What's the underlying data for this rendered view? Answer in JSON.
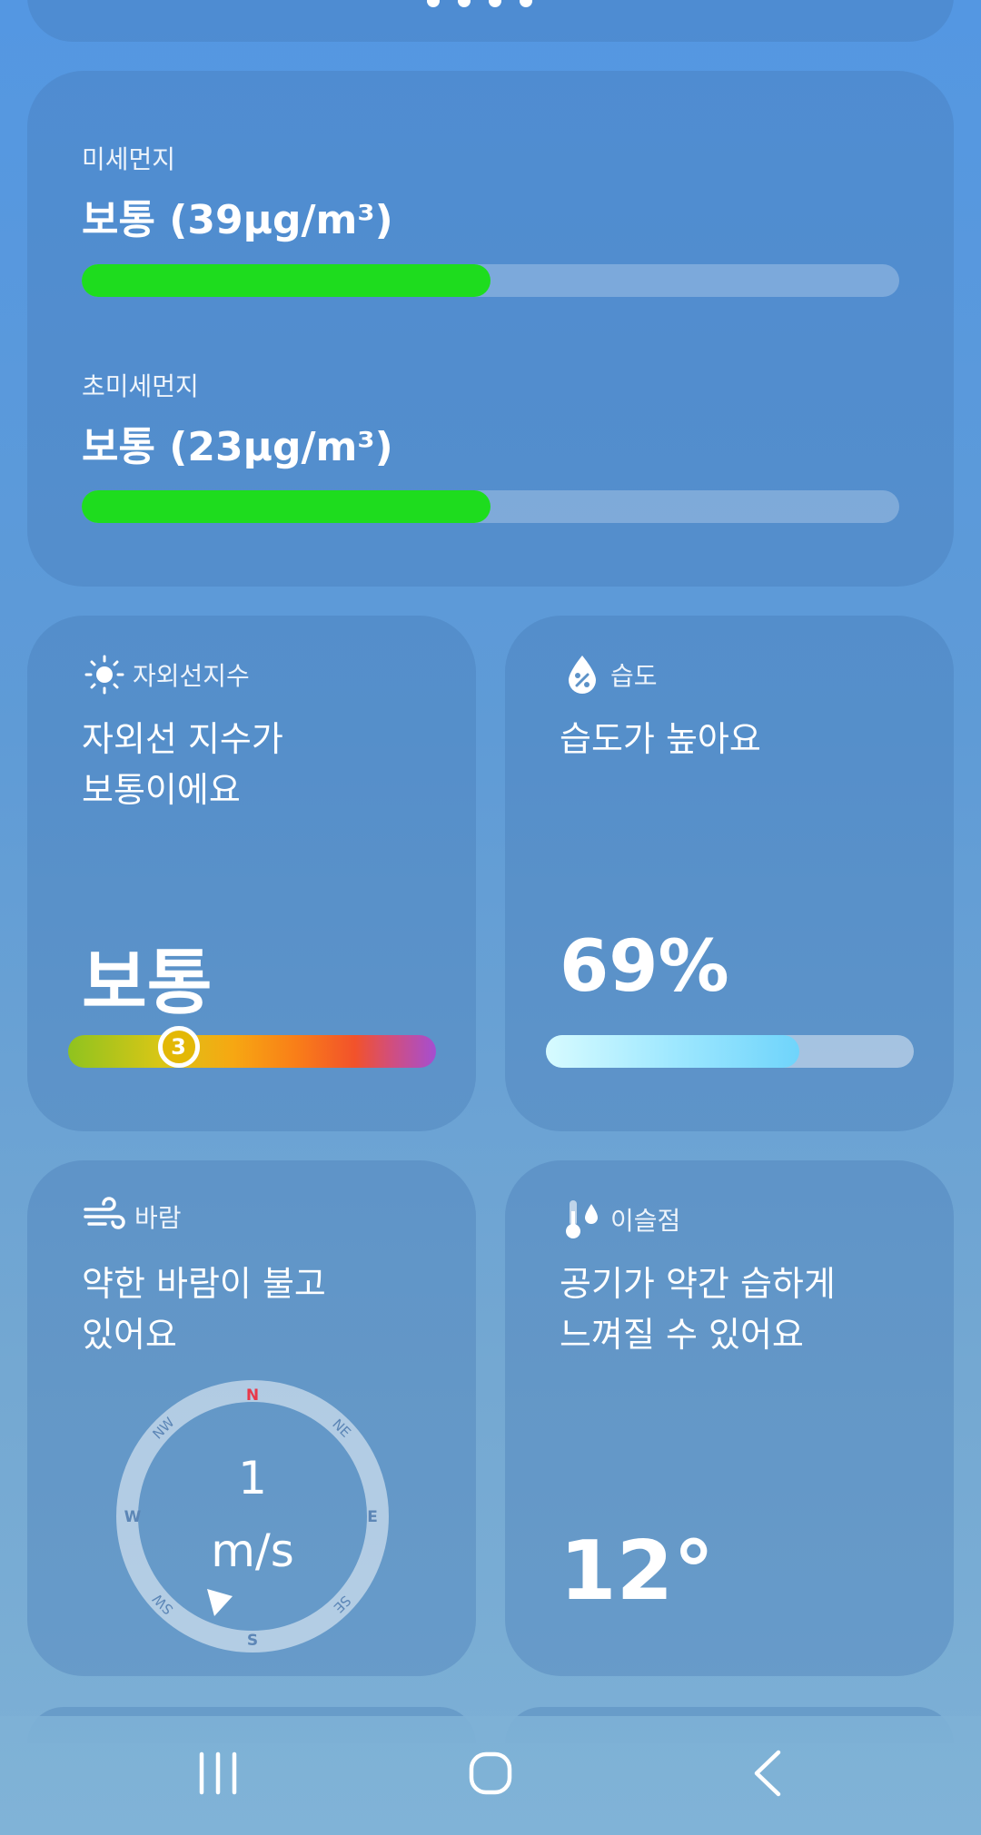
{
  "air_quality": {
    "fine_dust": {
      "label": "미세먼지",
      "value": "보통 (39μg/m³)",
      "level_fraction": 0.5
    },
    "ultrafine_dust": {
      "label": "초미세먼지",
      "value": "보통 (23μg/m³)",
      "level_fraction": 0.5
    },
    "good_color": "#1edc1e"
  },
  "uv": {
    "title": "자외선지수",
    "icon": "sun-icon",
    "description": "자외선 지수가\n보통이에요",
    "level": "보통",
    "index": "3",
    "index_fraction": 0.3
  },
  "humidity": {
    "title": "습도",
    "icon": "humidity-drop-icon",
    "description": "습도가 높아요",
    "value": "69%",
    "fraction": 0.69
  },
  "wind": {
    "title": "바람",
    "icon": "wind-icon",
    "description": "약한 바람이 불고\n있어요",
    "speed": "1",
    "unit": "m/s",
    "direction": "SW",
    "compass": {
      "N": "N",
      "NE": "NE",
      "E": "E",
      "SE": "SE",
      "S": "S",
      "SW": "SW",
      "W": "W",
      "NW": "NW"
    },
    "north_color": "#e8384a"
  },
  "dew_point": {
    "title": "이슬점",
    "icon": "thermometer-drop-icon",
    "description": "공기가 약간 습하게\n느껴질 수 있어요",
    "value": "12°"
  },
  "navigation": {
    "recent_icon": "recent-apps-icon",
    "home_icon": "home-icon",
    "back_icon": "back-icon"
  }
}
